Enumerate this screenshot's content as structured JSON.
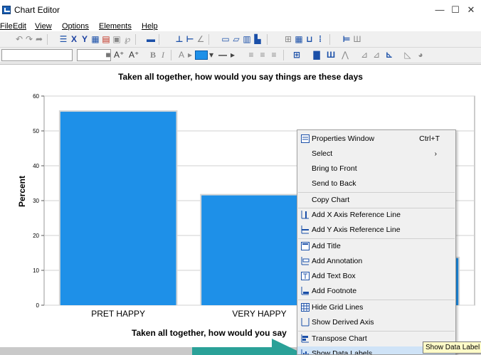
{
  "window": {
    "title": "Chart Editor",
    "minimize": "—",
    "maximize": "☐",
    "close": "✕"
  },
  "menubar": [
    "File",
    "Edit",
    "View",
    "Options",
    "Elements",
    "Help"
  ],
  "toolbar": {
    "text_size_up": "A⁺",
    "text_size_up2": "A⁺",
    "bold": "B",
    "italic": "I",
    "text_color": "A"
  },
  "chart_data": {
    "type": "bar",
    "title": "Taken all together, how would you say things are these days",
    "xlabel": "Taken all together, how would you say",
    "ylabel": "Percent",
    "categories": [
      "PRET HAPPY",
      "VERY HAPPY",
      ""
    ],
    "values": [
      55.5,
      31.5,
      13.5
    ],
    "ylim": [
      0,
      60
    ],
    "yticks": [
      "0",
      "10",
      "20",
      "30",
      "40",
      "50",
      "60"
    ],
    "bar_color": "#1e90e8",
    "grid": true
  },
  "context_menu": {
    "items": [
      {
        "label": "Properties Window",
        "shortcut": "Ctrl+T"
      },
      {
        "label": "Select",
        "arrow": "›"
      },
      {
        "label": "Bring to Front"
      },
      {
        "label": "Send to Back"
      },
      {
        "label": "Copy Chart"
      },
      {
        "label": "Add X Axis Reference Line"
      },
      {
        "label": "Add Y Axis Reference Line"
      },
      {
        "label": "Add Title"
      },
      {
        "label": "Add Annotation"
      },
      {
        "label": "Add Text Box"
      },
      {
        "label": "Add Footnote"
      },
      {
        "label": "Hide Grid Lines"
      },
      {
        "label": "Show Derived Axis"
      },
      {
        "label": "Transpose Chart"
      },
      {
        "label": "Show Data Labels"
      }
    ]
  },
  "tooltip": "Show Data Label",
  "colors": {
    "accent": "#1e90e8",
    "arrow": "#2aa198",
    "menu_highlight": "#cfe3f7"
  }
}
